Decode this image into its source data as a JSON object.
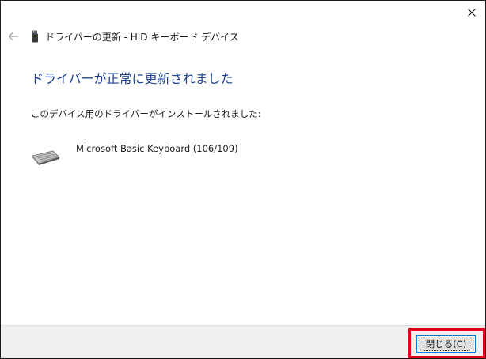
{
  "window": {
    "title": "ドライバーの更新 - HID キーボード デバイス"
  },
  "content": {
    "heading": "ドライバーが正常に更新されました",
    "subtext": "このデバイス用のドライバーがインストールされました:",
    "device_name": "Microsoft Basic Keyboard (106/109)"
  },
  "footer": {
    "close_label": "閉じる(C)"
  },
  "colors": {
    "heading": "#1c3f94",
    "highlight": "#e3001b",
    "focus_border": "#0078d7",
    "footer_bg": "#f0f0f0"
  },
  "icons": {
    "close": "close-icon",
    "back": "back-arrow-icon",
    "device": "usb-device-icon",
    "keyboard": "keyboard-icon"
  }
}
